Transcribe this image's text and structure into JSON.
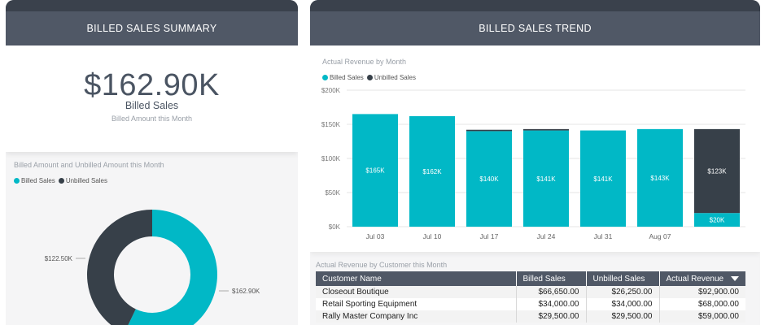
{
  "summary": {
    "title": "BILLED SALES SUMMARY",
    "kpi_value": "$162.90K",
    "kpi_label": "Billed Sales",
    "kpi_sublabel": "Billed Amount this Month"
  },
  "donut": {
    "title": "Billed Amount and Unbilled Amount this Month",
    "legend": [
      "Billed Sales",
      "Unbilled Sales"
    ],
    "billed_label": "$162.90K",
    "unbilled_label": "$122.50K"
  },
  "trend": {
    "title": "BILLED SALES TREND",
    "chart_title": "Actual Revenue by Month",
    "legend": [
      "Billed Sales",
      "Unbilled Sales"
    ]
  },
  "colors": {
    "billed": "#01b8c6",
    "unbilled": "#374049",
    "header": "#505866",
    "header_dark": "#3a414c"
  },
  "chart_data": [
    {
      "type": "bar",
      "title": "Actual Revenue by Month",
      "categories": [
        "Jul 03",
        "Jul 10",
        "Jul 17",
        "Jul 24",
        "Jul 31",
        "Aug 07"
      ],
      "series": [
        {
          "name": "Billed Sales",
          "values": [
            165,
            162,
            140,
            141,
            141,
            143,
            20
          ],
          "labels": [
            "$165K",
            "$162K",
            "$140K",
            "$141K",
            "$141K",
            "$143K",
            "$20K"
          ]
        },
        {
          "name": "Unbilled Sales",
          "values": [
            0,
            0,
            2,
            2,
            0,
            0,
            123
          ],
          "labels": [
            "",
            "",
            "",
            "",
            "",
            "",
            "$123K"
          ]
        }
      ],
      "y_ticks": [
        "$0K",
        "$50K",
        "$100K",
        "$150K",
        "$200K"
      ],
      "ylim": [
        0,
        200
      ],
      "grid": true,
      "stacked": true,
      "legend_position": "top-left"
    },
    {
      "type": "pie",
      "title": "Billed Amount and Unbilled Amount this Month",
      "categories": [
        "Billed Sales",
        "Unbilled Sales"
      ],
      "values": [
        162.9,
        122.5
      ],
      "labels": [
        "$162.90K",
        "$122.50K"
      ],
      "donut": true
    }
  ],
  "customers": {
    "title": "Actual Revenue by Customer this Month",
    "columns": [
      "Customer Name",
      "Billed Sales",
      "Unbilled Sales",
      "Actual Revenue"
    ],
    "rows": [
      [
        "Closeout Boutique",
        "$66,650.00",
        "$26,250.00",
        "$92,900.00"
      ],
      [
        "Retail Sporting Equipment",
        "$34,000.00",
        "$34,000.00",
        "$68,000.00"
      ],
      [
        "Rally Master Company Inc",
        "$29,500.00",
        "$29,500.00",
        "$59,000.00"
      ]
    ]
  }
}
